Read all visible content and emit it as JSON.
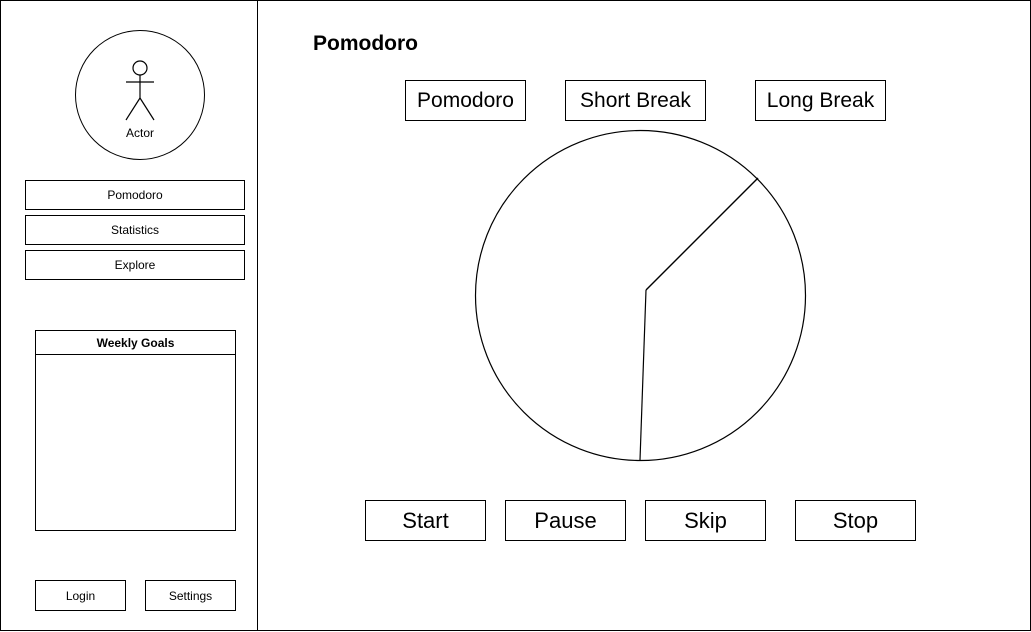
{
  "app": {
    "title": "Pomodoro"
  },
  "sidebar": {
    "avatar": {
      "label": "Actor",
      "icon": "actor-stick-figure-icon"
    },
    "nav": [
      {
        "label": "Pomodoro"
      },
      {
        "label": "Statistics"
      },
      {
        "label": "Explore"
      }
    ],
    "weekly_goals": {
      "title": "Weekly Goals"
    },
    "login_label": "Login",
    "settings_label": "Settings"
  },
  "main": {
    "title": "Pomodoro",
    "modes": [
      {
        "label": "Pomodoro"
      },
      {
        "label": "Short Break"
      },
      {
        "label": "Long Break"
      }
    ],
    "controls": [
      {
        "label": "Start"
      },
      {
        "label": "Pause"
      },
      {
        "label": "Skip"
      },
      {
        "label": "Stop"
      }
    ]
  }
}
